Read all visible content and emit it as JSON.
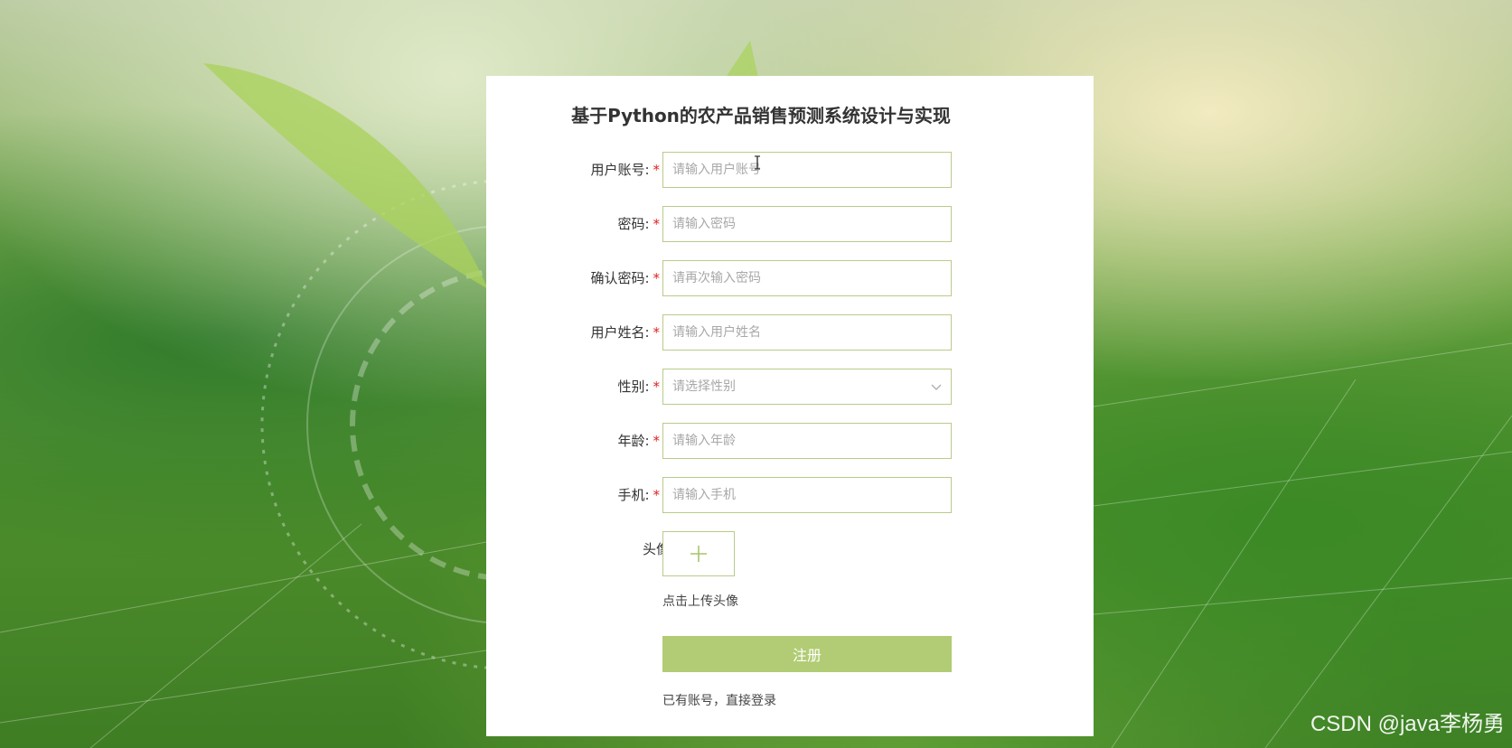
{
  "form": {
    "title": "基于Python的农产品销售预测系统设计与实现",
    "fields": [
      {
        "label": "用户账号:",
        "required": "*",
        "placeholder": "请输入用户账号"
      },
      {
        "label": "密码:",
        "required": "*",
        "placeholder": "请输入密码"
      },
      {
        "label": "确认密码:",
        "required": "*",
        "placeholder": "请再次输入密码"
      },
      {
        "label": "用户姓名:",
        "required": "*",
        "placeholder": "请输入用户姓名"
      },
      {
        "label": "性别:",
        "required": "*",
        "placeholder": "请选择性别"
      },
      {
        "label": "年龄:",
        "required": "*",
        "placeholder": "请输入年龄"
      },
      {
        "label": "手机:",
        "required": "*",
        "placeholder": "请输入手机"
      }
    ],
    "avatar": {
      "label": "头像:",
      "hint": "点击上传头像"
    },
    "submit_label": "注册",
    "login_link": "已有账号，直接登录"
  },
  "watermark": "CSDN @java李杨勇",
  "colors": {
    "accent": "#b1cc74",
    "border": "#b7cc8a",
    "required": "#e02020"
  },
  "icons": {
    "upload": "plus-icon",
    "select": "chevron-down-icon"
  }
}
